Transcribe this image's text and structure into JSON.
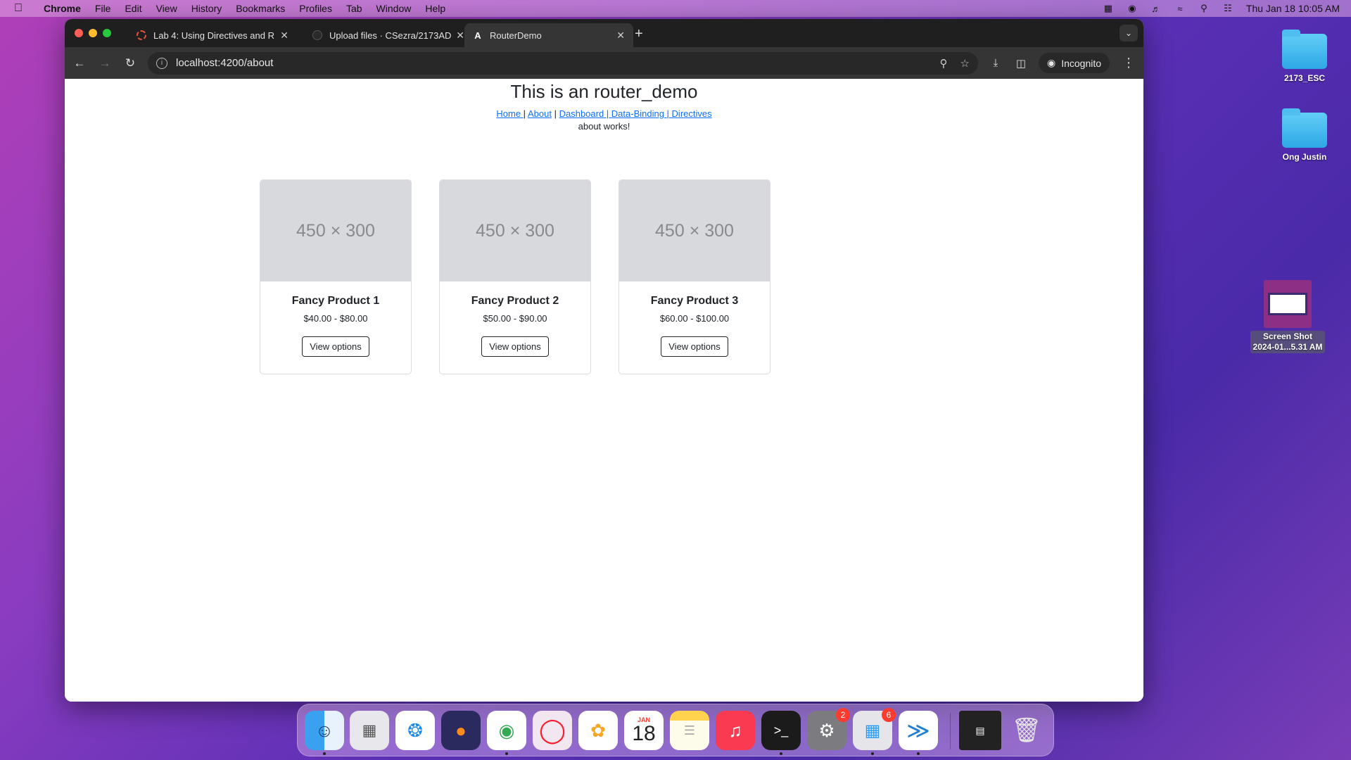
{
  "menubar": {
    "app": "Chrome",
    "items": [
      "File",
      "Edit",
      "View",
      "History",
      "Bookmarks",
      "Profiles",
      "Tab",
      "Window",
      "Help"
    ],
    "clock": "Thu Jan 18  10:05 AM"
  },
  "browser": {
    "tabs": [
      {
        "title": "Lab 4: Using Directives and R"
      },
      {
        "title": "Upload files · CSezra/2173AD"
      },
      {
        "title": "RouterDemo"
      }
    ],
    "url": "localhost:4200/about",
    "incognito_label": "Incognito"
  },
  "page": {
    "title": "This is an router_demo",
    "links": [
      "Home ",
      "About",
      "Dashboard | Data-Binding | Directives"
    ],
    "separator": "|",
    "message": "about works!",
    "products": [
      {
        "placeholder": "450 × 300",
        "name": "Fancy Product 1",
        "price": "$40.00 - $80.00",
        "button": "View options"
      },
      {
        "placeholder": "450 × 300",
        "name": "Fancy Product 2",
        "price": "$50.00 - $90.00",
        "button": "View options"
      },
      {
        "placeholder": "450 × 300",
        "name": "Fancy Product 3",
        "price": "$60.00 - $100.00",
        "button": "View options"
      }
    ]
  },
  "desktop": {
    "icons": [
      {
        "label": "2173_ESC"
      },
      {
        "label": "Ong Justin"
      }
    ],
    "screenshot": {
      "line1": "Screen Shot",
      "line2": "2024-01...5.31 AM"
    }
  },
  "dock": {
    "calendar": {
      "month": "JAN",
      "day": "18"
    },
    "badges": {
      "settings": "2",
      "store": "6"
    }
  },
  "colors": {
    "link": "#0d6efd",
    "placeholder_bg": "#d7d9dc",
    "chrome_dark": "#1f1f1f"
  }
}
